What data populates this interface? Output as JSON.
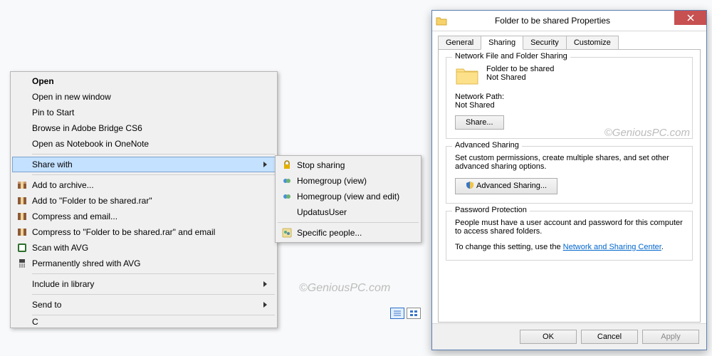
{
  "context_menu": {
    "open": "Open",
    "open_new_window": "Open in new window",
    "pin_to_start": "Pin to Start",
    "browse_bridge": "Browse in Adobe Bridge CS6",
    "open_onenote": "Open as Notebook in OneNote",
    "share_with": "Share with",
    "add_archive": "Add to archive...",
    "add_to_rar": "Add to \"Folder to be shared.rar\"",
    "compress_email": "Compress and email...",
    "compress_rar_email": "Compress to \"Folder to be shared.rar\" and email",
    "scan_avg": "Scan with AVG",
    "shred_avg": "Permanently shred with AVG",
    "include_library": "Include in library",
    "send_to": "Send to",
    "truncated": "C"
  },
  "share_submenu": {
    "stop_sharing": "Stop sharing",
    "homegroup_view": "Homegroup (view)",
    "homegroup_edit": "Homegroup (view and edit)",
    "updatus": "UpdatusUser",
    "specific": "Specific people..."
  },
  "dialog": {
    "title": "Folder to be shared Properties",
    "tabs": {
      "general": "General",
      "sharing": "Sharing",
      "security": "Security",
      "customize": "Customize"
    },
    "group1": {
      "title": "Network File and Folder Sharing",
      "folder_name": "Folder to be shared",
      "status": "Not Shared",
      "path_label": "Network Path:",
      "path_value": "Not Shared",
      "share_btn": "Share..."
    },
    "group2": {
      "title": "Advanced Sharing",
      "desc": "Set custom permissions, create multiple shares, and set other advanced sharing options.",
      "adv_btn": "Advanced Sharing..."
    },
    "group3": {
      "title": "Password Protection",
      "desc1": "People must have a user account and password for this computer to access shared folders.",
      "desc2a": "To change this setting, use the ",
      "link": "Network and Sharing Center",
      "desc2b": "."
    },
    "buttons": {
      "ok": "OK",
      "cancel": "Cancel",
      "apply": "Apply"
    }
  },
  "watermark": "©GeniousPC.com"
}
